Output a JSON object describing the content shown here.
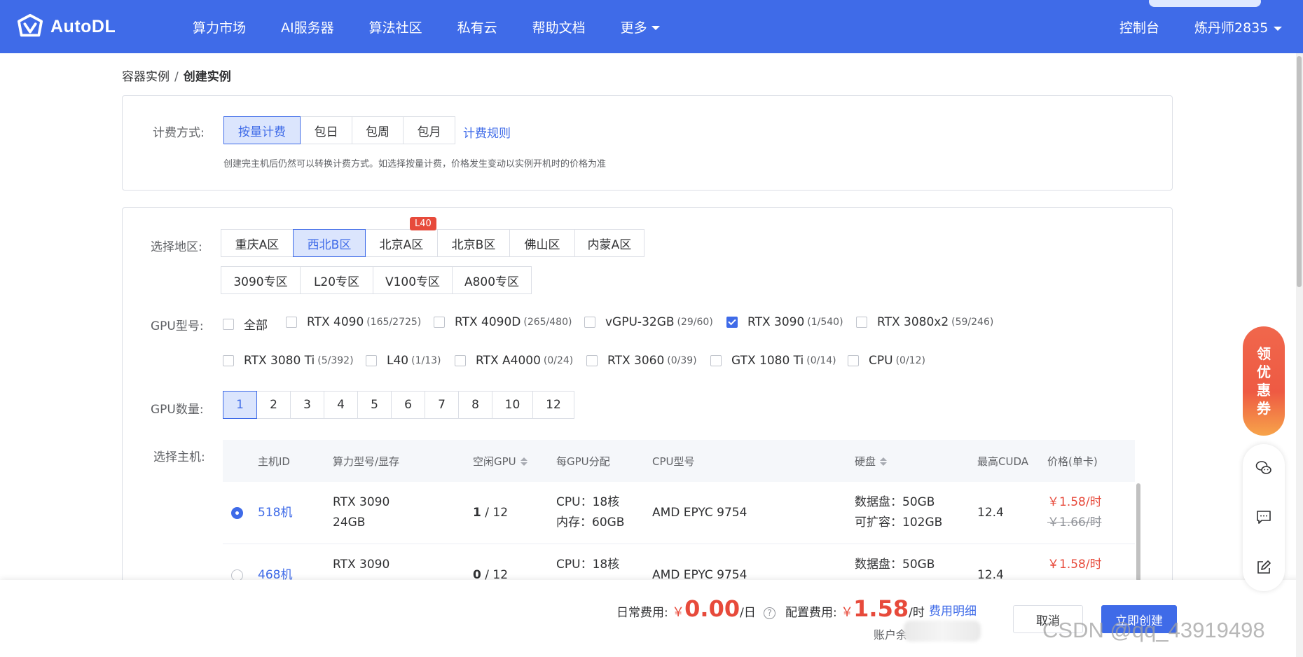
{
  "header": {
    "logo_text": "AutoDL",
    "nav": [
      "算力市场",
      "AI服务器",
      "算法社区",
      "私有云",
      "帮助文档",
      "更多"
    ],
    "console": "控制台",
    "user": "炼丹师2835"
  },
  "breadcrumb": {
    "parent": "容器实例",
    "sep": "/",
    "current": "创建实例"
  },
  "billing": {
    "label": "计费方式:",
    "options": [
      "按量计费",
      "包日",
      "包周",
      "包月"
    ],
    "selected": "按量计费",
    "rules_link": "计费规则",
    "hint": "创建完主机后仍然可以转换计费方式。如选择按量计费，价格发生变动以实例开机时的价格为准"
  },
  "region": {
    "label": "选择地区:",
    "row1": [
      "重庆A区",
      "西北B区",
      "北京A区",
      "北京B区",
      "佛山区",
      "内蒙A区"
    ],
    "row2": [
      "3090专区",
      "L20专区",
      "V100专区",
      "A800专区"
    ],
    "selected": "西北B区",
    "badge": "L40"
  },
  "gpu_model": {
    "label": "GPU型号:",
    "row1": [
      {
        "name": "全部",
        "count": "",
        "checked": false
      },
      {
        "name": "RTX 4090",
        "count": "(165/2725)",
        "checked": false
      },
      {
        "name": "RTX 4090D",
        "count": "(265/480)",
        "checked": false
      },
      {
        "name": "vGPU-32GB",
        "count": "(29/60)",
        "checked": false
      },
      {
        "name": "RTX 3090",
        "count": "(1/540)",
        "checked": true
      },
      {
        "name": "RTX 3080x2",
        "count": "(59/246)",
        "checked": false
      }
    ],
    "row2": [
      {
        "name": "RTX 3080 Ti",
        "count": "(5/392)",
        "checked": false
      },
      {
        "name": "L40",
        "count": "(1/13)",
        "checked": false
      },
      {
        "name": "RTX A4000",
        "count": "(0/24)",
        "checked": false
      },
      {
        "name": "RTX 3060",
        "count": "(0/39)",
        "checked": false
      },
      {
        "name": "GTX 1080 Ti",
        "count": "(0/14)",
        "checked": false
      },
      {
        "name": "CPU",
        "count": "(0/12)",
        "checked": false
      }
    ]
  },
  "gpu_count": {
    "label": "GPU数量:",
    "options": [
      "1",
      "2",
      "3",
      "4",
      "5",
      "6",
      "7",
      "8",
      "10",
      "12"
    ],
    "selected": "1"
  },
  "host": {
    "label": "选择主机:",
    "columns": [
      "主机ID",
      "算力型号/显存",
      "空闲GPU",
      "每GPU分配",
      "CPU型号",
      "硬盘",
      "最高CUDA",
      "价格(单卡)"
    ],
    "rows": [
      {
        "id": "518机",
        "model": "RTX 3090",
        "vram": "24GB",
        "free": "1",
        "total": "/ 12",
        "cpu_alloc": "CPU：18核",
        "mem_alloc": "内存：60GB",
        "cpu_model": "AMD EPYC 9754",
        "disk": "数据盘：50GB",
        "disk_ext": "可扩容：102GB",
        "cuda": "12.4",
        "price": "￥1.58/时",
        "old_price": "￥1.66/时",
        "selected": true
      },
      {
        "id": "468机",
        "model": "RTX 3090",
        "vram": "",
        "free": "0",
        "total": "/ 12",
        "cpu_alloc": "CPU：18核",
        "mem_alloc": "",
        "cpu_model": "AMD EPYC 9754",
        "disk": "数据盘：50GB",
        "disk_ext": "",
        "cuda": "12.4",
        "price": "￥1.58/时",
        "old_price": "",
        "selected": false
      }
    ]
  },
  "footer": {
    "daily_label": "日常费用:",
    "daily_yen": "￥",
    "daily_value": "0.00",
    "daily_unit": "/日",
    "help_icon": "?",
    "config_label": "配置费用:",
    "config_yen": "￥",
    "config_value": "1.58",
    "config_unit": "/时",
    "detail_link": "费用明细",
    "cancel": "取消",
    "create": "立即创建",
    "account": "账户余"
  },
  "floating": {
    "coupon": [
      "领",
      "优",
      "惠",
      "券"
    ]
  },
  "watermark": "CSDN @qq_43919498",
  "colors": {
    "primary": "#3f6be8",
    "price": "#e74a3b"
  }
}
